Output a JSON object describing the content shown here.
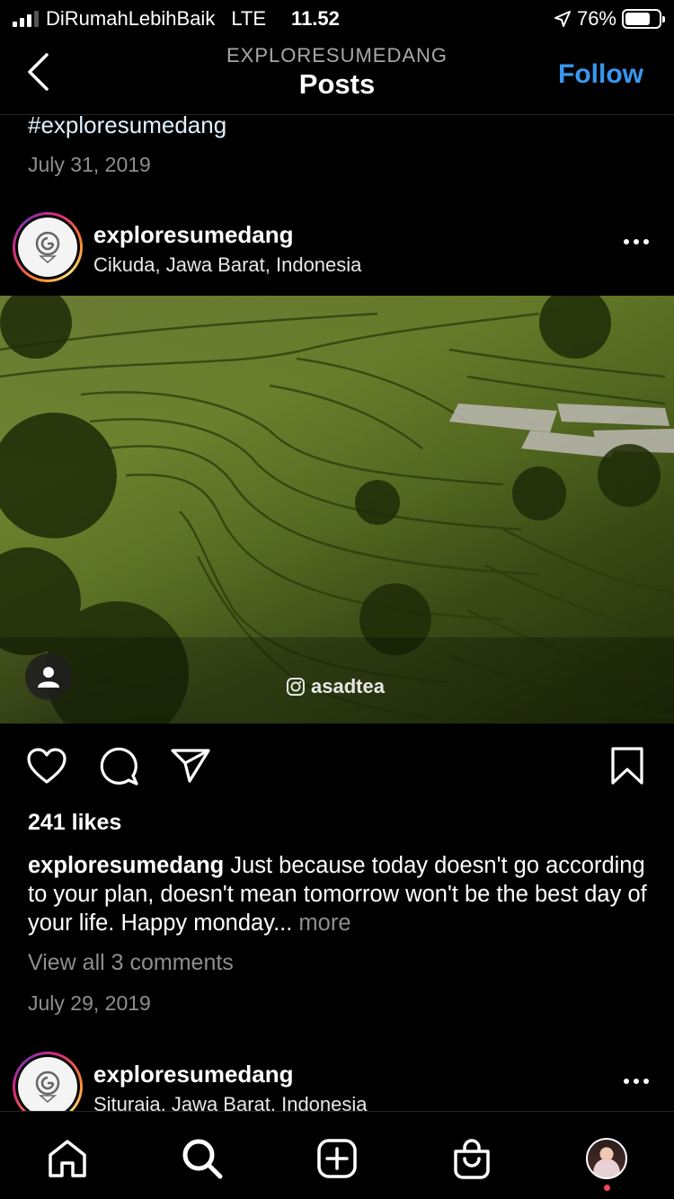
{
  "status_bar": {
    "carrier": "DiRumahLebihBaik",
    "network": "LTE",
    "time": "11.52",
    "battery": "76%",
    "battery_level": 0.76
  },
  "header": {
    "account": "EXPLORESUMEDANG",
    "title": "Posts",
    "follow_label": "Follow"
  },
  "previous_post": {
    "hashtag": "#exploresumedang",
    "date": "July 31, 2019"
  },
  "post": {
    "username": "exploresumedang",
    "location": "Cikuda, Jawa Barat, Indonesia",
    "photo_watermark": "asadtea",
    "likes": "241 likes",
    "caption_user": "exploresumedang",
    "caption_text": " Just because today doesn't go according to your plan, doesn't mean tomorrow won't be the best day of your life. Happy monday...",
    "caption_more": " more",
    "view_comments": "View all 3 comments",
    "date": "July 29, 2019"
  },
  "next_post": {
    "username": "exploresumedang",
    "location": "Situraja, Jawa Barat, Indonesia"
  },
  "icons": {
    "back": "chevron-left-icon",
    "like": "heart-icon",
    "comment": "comment-icon",
    "share": "paper-plane-icon",
    "save": "bookmark-icon",
    "tabs": [
      "home-icon",
      "search-icon",
      "add-post-icon",
      "shop-icon",
      "profile-avatar"
    ]
  },
  "colors": {
    "accent": "#3897f0",
    "background": "#000000",
    "muted_text": "#8e8e8e",
    "notification": "#ed4956"
  }
}
